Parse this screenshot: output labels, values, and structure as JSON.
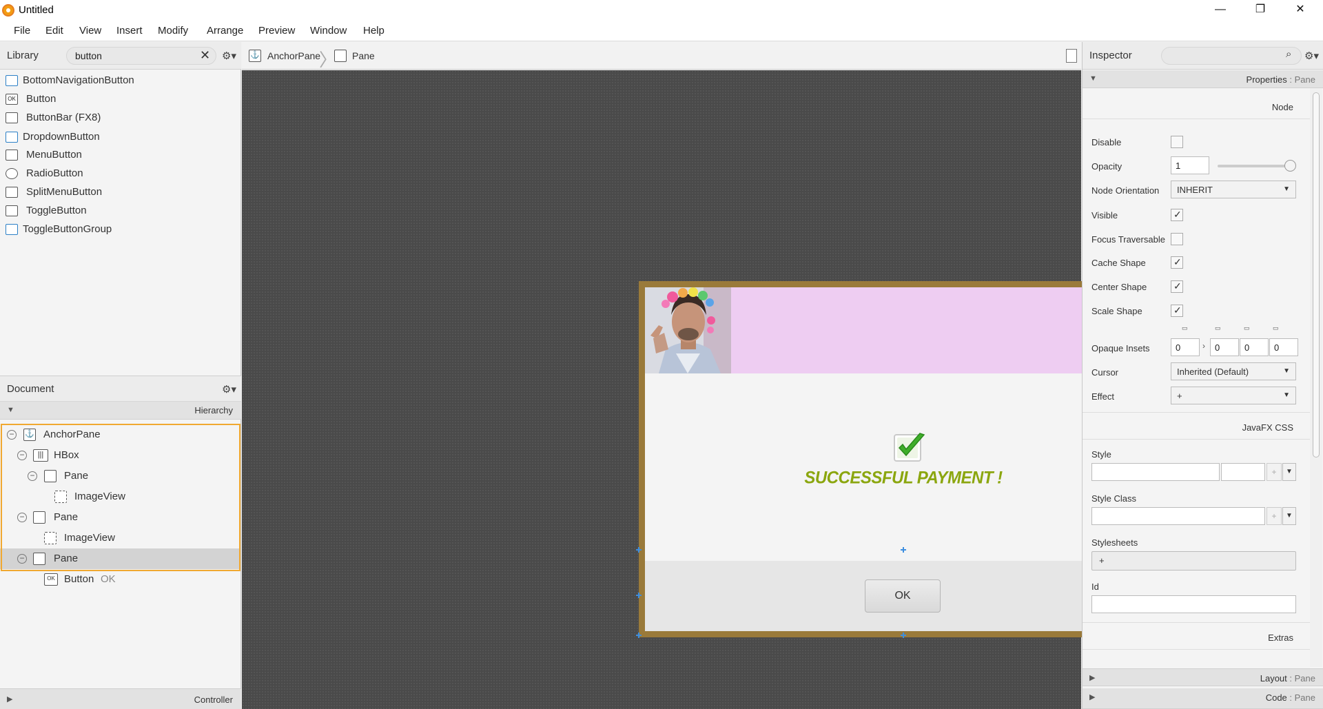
{
  "window": {
    "title": "Untitled",
    "minimize": "—",
    "restore": "❐",
    "close": "✕"
  },
  "menu": [
    "File",
    "Edit",
    "View",
    "Insert",
    "Modify",
    "Arrange",
    "Preview",
    "Window",
    "Help"
  ],
  "library": {
    "title": "Library",
    "search_value": "button",
    "items": [
      {
        "label": "BottomNavigationButton",
        "icon": "bottom-navigation-icon"
      },
      {
        "label": "Button",
        "icon": "ok-button-icon"
      },
      {
        "label": "ButtonBar  (FX8)",
        "icon": "button-bar-icon"
      },
      {
        "label": "DropdownButton",
        "icon": "dropdown-button-icon"
      },
      {
        "label": "MenuButton",
        "icon": "menu-button-icon"
      },
      {
        "label": "RadioButton",
        "icon": "radio-button-icon"
      },
      {
        "label": "SplitMenuButton",
        "icon": "split-menu-button-icon"
      },
      {
        "label": "ToggleButton",
        "icon": "toggle-button-icon"
      },
      {
        "label": "ToggleButtonGroup",
        "icon": "toggle-button-group-icon"
      }
    ]
  },
  "document": {
    "title": "Document",
    "hierarchy_label": "Hierarchy",
    "controller_label": "Controller",
    "tree": [
      {
        "label": "AnchorPane",
        "icon": "anchor-pane-icon",
        "sub": ""
      },
      {
        "label": "HBox",
        "icon": "hbox-icon",
        "sub": ""
      },
      {
        "label": "Pane",
        "icon": "pane-icon",
        "sub": ""
      },
      {
        "label": "ImageView",
        "icon": "image-view-icon",
        "sub": ""
      },
      {
        "label": "Pane",
        "icon": "pane-icon",
        "sub": ""
      },
      {
        "label": "ImageView",
        "icon": "image-view-icon",
        "sub": ""
      },
      {
        "label": "Pane",
        "icon": "pane-icon",
        "sub": ""
      },
      {
        "label": "Button",
        "icon": "ok-button-icon",
        "sub": "OK"
      }
    ]
  },
  "breadcrumb": [
    {
      "label": "AnchorPane",
      "icon": "anchor-pane-icon"
    },
    {
      "label": "Pane",
      "icon": "pane-icon"
    }
  ],
  "scene": {
    "message": "SUCCESSFUL PAYMENT !",
    "ok_label": "OK",
    "colors": {
      "frame": "#9a7a3a",
      "header_band": "#eecdf2",
      "message_green": "#8ba60f",
      "button_area": "#e6e6e6"
    }
  },
  "inspector": {
    "title": "Inspector",
    "properties_bar": {
      "label": "Properties",
      "separator": " : ",
      "target": "Pane"
    },
    "layout_bar": {
      "label": "Layout",
      "separator": " : ",
      "target": "Pane"
    },
    "code_bar": {
      "label": "Code",
      "separator": " : ",
      "target": "Pane"
    },
    "groups": {
      "node": "Node",
      "javafx_css": "JavaFX CSS",
      "extras": "Extras"
    },
    "props": {
      "disable": {
        "label": "Disable",
        "checked": false
      },
      "opacity": {
        "label": "Opacity",
        "value": "1",
        "slider_value": 1
      },
      "node_orientation": {
        "label": "Node Orientation",
        "value": "INHERIT"
      },
      "visible": {
        "label": "Visible",
        "checked": true
      },
      "focus_traversable": {
        "label": "Focus Traversable",
        "checked": false
      },
      "cache_shape": {
        "label": "Cache Shape",
        "checked": true
      },
      "center_shape": {
        "label": "Center Shape",
        "checked": true
      },
      "scale_shape": {
        "label": "Scale Shape",
        "checked": true
      },
      "opaque_insets": {
        "label": "Opaque Insets",
        "values": [
          "0",
          "0",
          "0",
          "0"
        ]
      },
      "cursor": {
        "label": "Cursor",
        "value": "Inherited (Default)"
      },
      "effect": {
        "label": "Effect",
        "value": "+"
      },
      "style": {
        "label": "Style",
        "value": ""
      },
      "style_class": {
        "label": "Style Class",
        "value": ""
      },
      "stylesheets": {
        "label": "Stylesheets",
        "value": "+"
      },
      "id": {
        "label": "Id",
        "value": ""
      }
    }
  }
}
